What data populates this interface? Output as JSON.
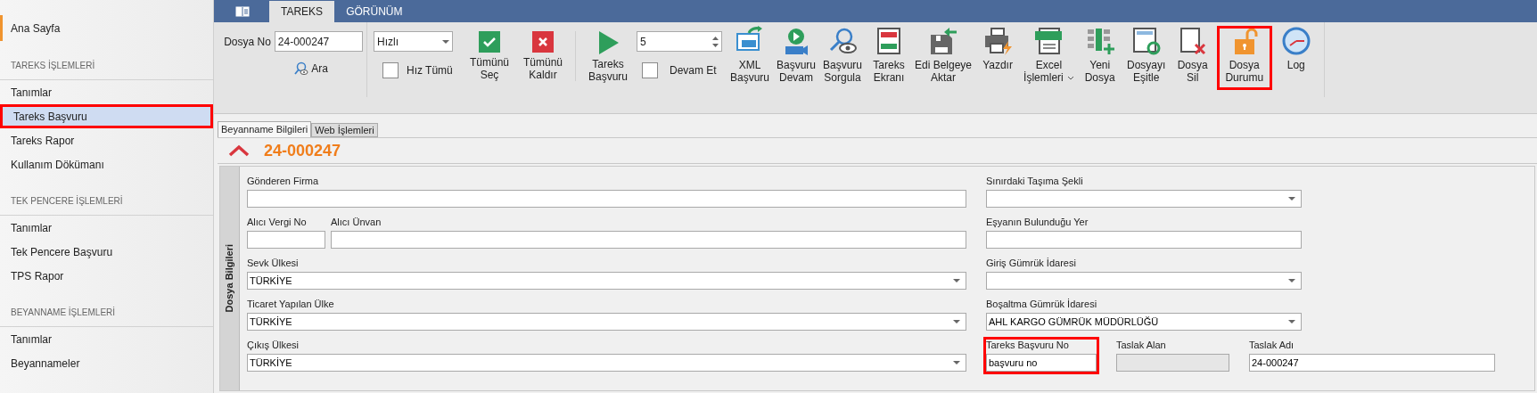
{
  "sidebar": {
    "home": {
      "label": "Ana Sayfa"
    },
    "sections": [
      {
        "title": "TAREKS İŞLEMLERİ",
        "items": [
          {
            "label": "Tanımlar",
            "selected": false,
            "highlighted": false
          },
          {
            "label": "Tareks Başvuru",
            "selected": true,
            "highlighted": true
          },
          {
            "label": "Tareks Rapor",
            "selected": false,
            "highlighted": false
          },
          {
            "label": "Kullanım Dökümanı",
            "selected": false,
            "highlighted": false
          }
        ]
      },
      {
        "title": "TEK PENCERE İŞLEMLERİ",
        "items": [
          {
            "label": "Tanımlar",
            "selected": false,
            "highlighted": false
          },
          {
            "label": "Tek Pencere Başvuru",
            "selected": false,
            "highlighted": false
          },
          {
            "label": "TPS Rapor",
            "selected": false,
            "highlighted": false
          }
        ]
      },
      {
        "title": "BEYANNAME İŞLEMLERİ",
        "items": [
          {
            "label": "Tanımlar",
            "selected": false,
            "highlighted": false
          },
          {
            "label": "Beyannameler",
            "selected": false,
            "highlighted": false
          }
        ]
      }
    ]
  },
  "ribbon_tabs": [
    {
      "label": "TAREKS",
      "selected": true
    },
    {
      "label": "GÖRÜNÜM",
      "selected": false
    }
  ],
  "ribbon": {
    "dosya_no": {
      "label": "Dosya No",
      "value": "24-000247"
    },
    "search_button": {
      "label": "Ara"
    },
    "speed_select": {
      "value": "Hızlı"
    },
    "speed_all": {
      "label": "Hız Tümü",
      "checked": false
    },
    "select_buttons": [
      {
        "label": "Tümünü\nSeç"
      },
      {
        "label": "Tümünü\nKaldır"
      }
    ],
    "apply_button": {
      "label": "Tareks\nBaşvuru"
    },
    "count": {
      "value": "5"
    },
    "continue": {
      "label": "Devam Et",
      "checked": false
    },
    "actions": [
      {
        "label": "XML\nBaşvuru",
        "highlighted": false,
        "dropdown": false
      },
      {
        "label": "Başvuru\nDevam",
        "highlighted": false,
        "dropdown": false
      },
      {
        "label": "Başvuru\nSorgula",
        "highlighted": false,
        "dropdown": false
      },
      {
        "label": "Tareks\nEkranı",
        "highlighted": false,
        "dropdown": false
      },
      {
        "label": "Edi Belgeye\nAktar",
        "highlighted": false,
        "dropdown": false
      },
      {
        "label": "Yazdır",
        "highlighted": false,
        "dropdown": false
      },
      {
        "label": "Excel\nİşlemleri",
        "highlighted": false,
        "dropdown": true
      },
      {
        "label": "Yeni\nDosya",
        "highlighted": false,
        "dropdown": false
      },
      {
        "label": "Dosyayı\nEşitle",
        "highlighted": false,
        "dropdown": false
      },
      {
        "label": "Dosya\nSil",
        "highlighted": false,
        "dropdown": false
      },
      {
        "label": "Dosya\nDurumu",
        "highlighted": true,
        "dropdown": false
      },
      {
        "label": "Log",
        "highlighted": false,
        "dropdown": false
      }
    ]
  },
  "form_tabs": [
    {
      "label": "Beyanname Bilgileri",
      "selected": true
    },
    {
      "label": "Web İşlemleri",
      "selected": false
    }
  ],
  "header": {
    "title": "24-000247"
  },
  "group": {
    "title": "Dosya Bilgileri",
    "left_rows": [
      [
        {
          "label": "Gönderen Firma",
          "kind": "text",
          "disabled": false,
          "highlighted": false
        }
      ],
      [
        {
          "label": "Alıcı Vergi No",
          "kind": "text",
          "disabled": false,
          "highlighted": false
        },
        {
          "label": "Alıcı Ünvan",
          "kind": "text",
          "disabled": false,
          "highlighted": false
        }
      ],
      [
        {
          "label": "Sevk Ülkesi",
          "kind": "select",
          "value": "TÜRKİYE",
          "disabled": false,
          "highlighted": false
        }
      ],
      [
        {
          "label": "Ticaret Yapılan Ülke",
          "kind": "select",
          "value": "TÜRKİYE",
          "disabled": false,
          "highlighted": false
        }
      ],
      [
        {
          "label": "Çıkış Ülkesi",
          "kind": "select",
          "value": "TÜRKİYE",
          "disabled": false,
          "highlighted": false
        }
      ]
    ],
    "right_rows": [
      [
        {
          "label": "Sınırdaki Taşıma Şekli",
          "kind": "select",
          "disabled": false,
          "highlighted": false
        }
      ],
      [
        {
          "label": "Eşyanın Bulunduğu Yer",
          "kind": "text",
          "disabled": false,
          "highlighted": false
        }
      ],
      [
        {
          "label": "Giriş Gümrük İdaresi",
          "kind": "select",
          "disabled": false,
          "highlighted": false
        }
      ],
      [
        {
          "label": "Boşaltma Gümrük İdaresi",
          "kind": "select",
          "value": "AHL KARGO GÜMRÜK MÜDÜRLÜĞÜ",
          "disabled": false,
          "highlighted": false
        }
      ],
      [
        {
          "label": "Tareks Başvuru No",
          "kind": "text",
          "value": "başvuru no",
          "disabled": false,
          "highlighted": true
        },
        {
          "label": "Taslak Alan",
          "kind": "text",
          "disabled": true,
          "highlighted": false
        },
        {
          "label": "Taslak Adı",
          "kind": "text",
          "value": "24-000247",
          "disabled": false,
          "highlighted": false
        }
      ]
    ]
  }
}
